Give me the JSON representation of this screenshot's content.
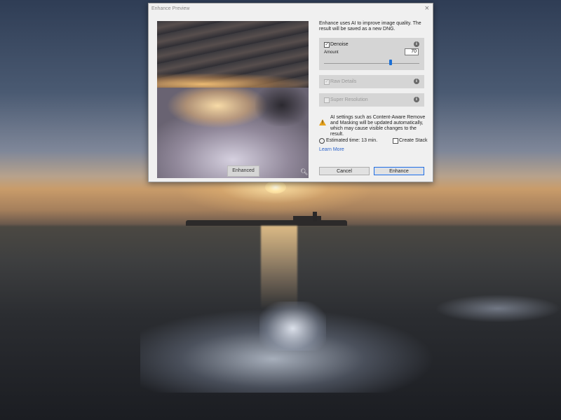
{
  "dialog": {
    "title": "Enhance Preview",
    "close_glyph": "×",
    "preview_label": "Enhanced",
    "description": "Enhance uses AI to improve image quality. The result will be saved as a new DNG.",
    "denoise": {
      "checked": true,
      "label": "Denoise",
      "amount_label": "Amount",
      "amount_value": "70",
      "amount_fraction": 0.7
    },
    "raw_details": {
      "checked": true,
      "disabled": true,
      "label": "Raw Details"
    },
    "super_resolution": {
      "checked": false,
      "disabled": true,
      "label": "Super Resolution"
    },
    "warning": "AI settings such as Content-Aware Remove and Masking will be updated automatically, which may cause visible changes to the result.",
    "estimated_time": "Estimated time: 13 min.",
    "create_stack_label": "Create Stack",
    "create_stack_checked": false,
    "learn_more": "Learn More",
    "cancel_label": "Cancel",
    "enhance_label": "Enhance"
  },
  "icons": {
    "info": "info-icon",
    "warning": "warning-icon",
    "clock": "clock-icon",
    "zoom": "zoom-icon",
    "check_glyph": "✓",
    "info_glyph": "i",
    "warn_glyph": "!"
  },
  "colors": {
    "accent": "#1a6fd6",
    "link": "#2a62c9",
    "warning": "#e5a11c",
    "panel": "#d5d5d5",
    "dialog_bg": "#f0f0f0"
  }
}
